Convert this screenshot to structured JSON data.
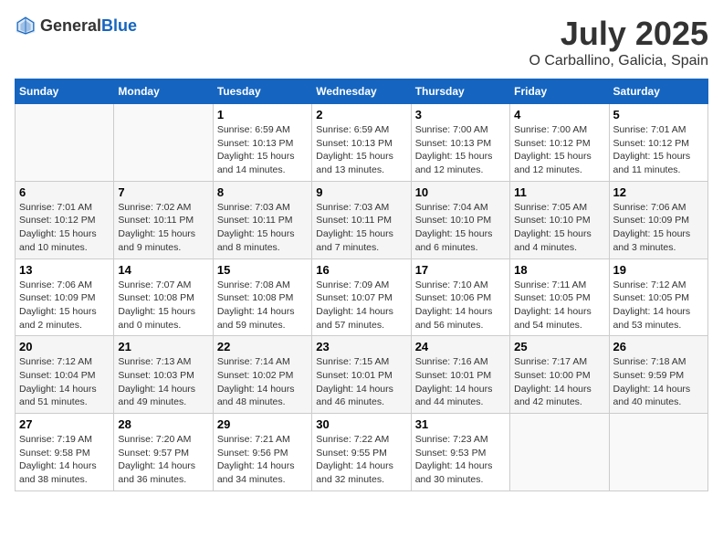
{
  "header": {
    "logo_general": "General",
    "logo_blue": "Blue",
    "month_title": "July 2025",
    "location": "O Carballino, Galicia, Spain"
  },
  "weekdays": [
    "Sunday",
    "Monday",
    "Tuesday",
    "Wednesday",
    "Thursday",
    "Friday",
    "Saturday"
  ],
  "weeks": [
    [
      {
        "day": "",
        "info": ""
      },
      {
        "day": "",
        "info": ""
      },
      {
        "day": "1",
        "info": "Sunrise: 6:59 AM\nSunset: 10:13 PM\nDaylight: 15 hours\nand 14 minutes."
      },
      {
        "day": "2",
        "info": "Sunrise: 6:59 AM\nSunset: 10:13 PM\nDaylight: 15 hours\nand 13 minutes."
      },
      {
        "day": "3",
        "info": "Sunrise: 7:00 AM\nSunset: 10:13 PM\nDaylight: 15 hours\nand 12 minutes."
      },
      {
        "day": "4",
        "info": "Sunrise: 7:00 AM\nSunset: 10:12 PM\nDaylight: 15 hours\nand 12 minutes."
      },
      {
        "day": "5",
        "info": "Sunrise: 7:01 AM\nSunset: 10:12 PM\nDaylight: 15 hours\nand 11 minutes."
      }
    ],
    [
      {
        "day": "6",
        "info": "Sunrise: 7:01 AM\nSunset: 10:12 PM\nDaylight: 15 hours\nand 10 minutes."
      },
      {
        "day": "7",
        "info": "Sunrise: 7:02 AM\nSunset: 10:11 PM\nDaylight: 15 hours\nand 9 minutes."
      },
      {
        "day": "8",
        "info": "Sunrise: 7:03 AM\nSunset: 10:11 PM\nDaylight: 15 hours\nand 8 minutes."
      },
      {
        "day": "9",
        "info": "Sunrise: 7:03 AM\nSunset: 10:11 PM\nDaylight: 15 hours\nand 7 minutes."
      },
      {
        "day": "10",
        "info": "Sunrise: 7:04 AM\nSunset: 10:10 PM\nDaylight: 15 hours\nand 6 minutes."
      },
      {
        "day": "11",
        "info": "Sunrise: 7:05 AM\nSunset: 10:10 PM\nDaylight: 15 hours\nand 4 minutes."
      },
      {
        "day": "12",
        "info": "Sunrise: 7:06 AM\nSunset: 10:09 PM\nDaylight: 15 hours\nand 3 minutes."
      }
    ],
    [
      {
        "day": "13",
        "info": "Sunrise: 7:06 AM\nSunset: 10:09 PM\nDaylight: 15 hours\nand 2 minutes."
      },
      {
        "day": "14",
        "info": "Sunrise: 7:07 AM\nSunset: 10:08 PM\nDaylight: 15 hours\nand 0 minutes."
      },
      {
        "day": "15",
        "info": "Sunrise: 7:08 AM\nSunset: 10:08 PM\nDaylight: 14 hours\nand 59 minutes."
      },
      {
        "day": "16",
        "info": "Sunrise: 7:09 AM\nSunset: 10:07 PM\nDaylight: 14 hours\nand 57 minutes."
      },
      {
        "day": "17",
        "info": "Sunrise: 7:10 AM\nSunset: 10:06 PM\nDaylight: 14 hours\nand 56 minutes."
      },
      {
        "day": "18",
        "info": "Sunrise: 7:11 AM\nSunset: 10:05 PM\nDaylight: 14 hours\nand 54 minutes."
      },
      {
        "day": "19",
        "info": "Sunrise: 7:12 AM\nSunset: 10:05 PM\nDaylight: 14 hours\nand 53 minutes."
      }
    ],
    [
      {
        "day": "20",
        "info": "Sunrise: 7:12 AM\nSunset: 10:04 PM\nDaylight: 14 hours\nand 51 minutes."
      },
      {
        "day": "21",
        "info": "Sunrise: 7:13 AM\nSunset: 10:03 PM\nDaylight: 14 hours\nand 49 minutes."
      },
      {
        "day": "22",
        "info": "Sunrise: 7:14 AM\nSunset: 10:02 PM\nDaylight: 14 hours\nand 48 minutes."
      },
      {
        "day": "23",
        "info": "Sunrise: 7:15 AM\nSunset: 10:01 PM\nDaylight: 14 hours\nand 46 minutes."
      },
      {
        "day": "24",
        "info": "Sunrise: 7:16 AM\nSunset: 10:01 PM\nDaylight: 14 hours\nand 44 minutes."
      },
      {
        "day": "25",
        "info": "Sunrise: 7:17 AM\nSunset: 10:00 PM\nDaylight: 14 hours\nand 42 minutes."
      },
      {
        "day": "26",
        "info": "Sunrise: 7:18 AM\nSunset: 9:59 PM\nDaylight: 14 hours\nand 40 minutes."
      }
    ],
    [
      {
        "day": "27",
        "info": "Sunrise: 7:19 AM\nSunset: 9:58 PM\nDaylight: 14 hours\nand 38 minutes."
      },
      {
        "day": "28",
        "info": "Sunrise: 7:20 AM\nSunset: 9:57 PM\nDaylight: 14 hours\nand 36 minutes."
      },
      {
        "day": "29",
        "info": "Sunrise: 7:21 AM\nSunset: 9:56 PM\nDaylight: 14 hours\nand 34 minutes."
      },
      {
        "day": "30",
        "info": "Sunrise: 7:22 AM\nSunset: 9:55 PM\nDaylight: 14 hours\nand 32 minutes."
      },
      {
        "day": "31",
        "info": "Sunrise: 7:23 AM\nSunset: 9:53 PM\nDaylight: 14 hours\nand 30 minutes."
      },
      {
        "day": "",
        "info": ""
      },
      {
        "day": "",
        "info": ""
      }
    ]
  ]
}
